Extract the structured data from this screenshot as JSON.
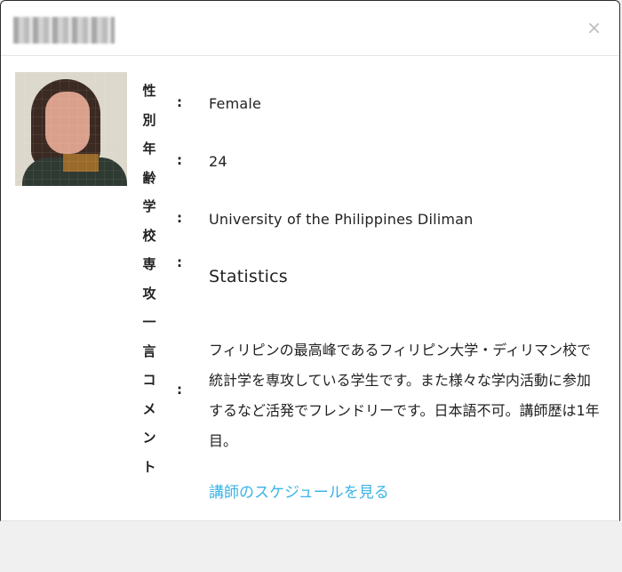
{
  "modal": {
    "close_symbol": "×"
  },
  "profile": {
    "label_chars": [
      "性",
      "別",
      "年",
      "齢",
      "学",
      "校",
      "専",
      "攻",
      "一",
      "言",
      "コ",
      "メ",
      "ン",
      "ト"
    ],
    "colon": ":",
    "gender": "Female",
    "age": "24",
    "school": "University of the Philippines Diliman",
    "major": "Statistics",
    "comment": "フィリピンの最高峰であるフィリピン大学・ディリマン校で統計学を専攻している学生です。また様々な学内活動に参加するなど活発でフレンドリーです。日本語不可。講師歴は1年目。",
    "schedule_link": "講師のスケジュールを見る"
  },
  "colors": {
    "link": "#3bb4e5",
    "close_icon": "#bdbdbd"
  }
}
